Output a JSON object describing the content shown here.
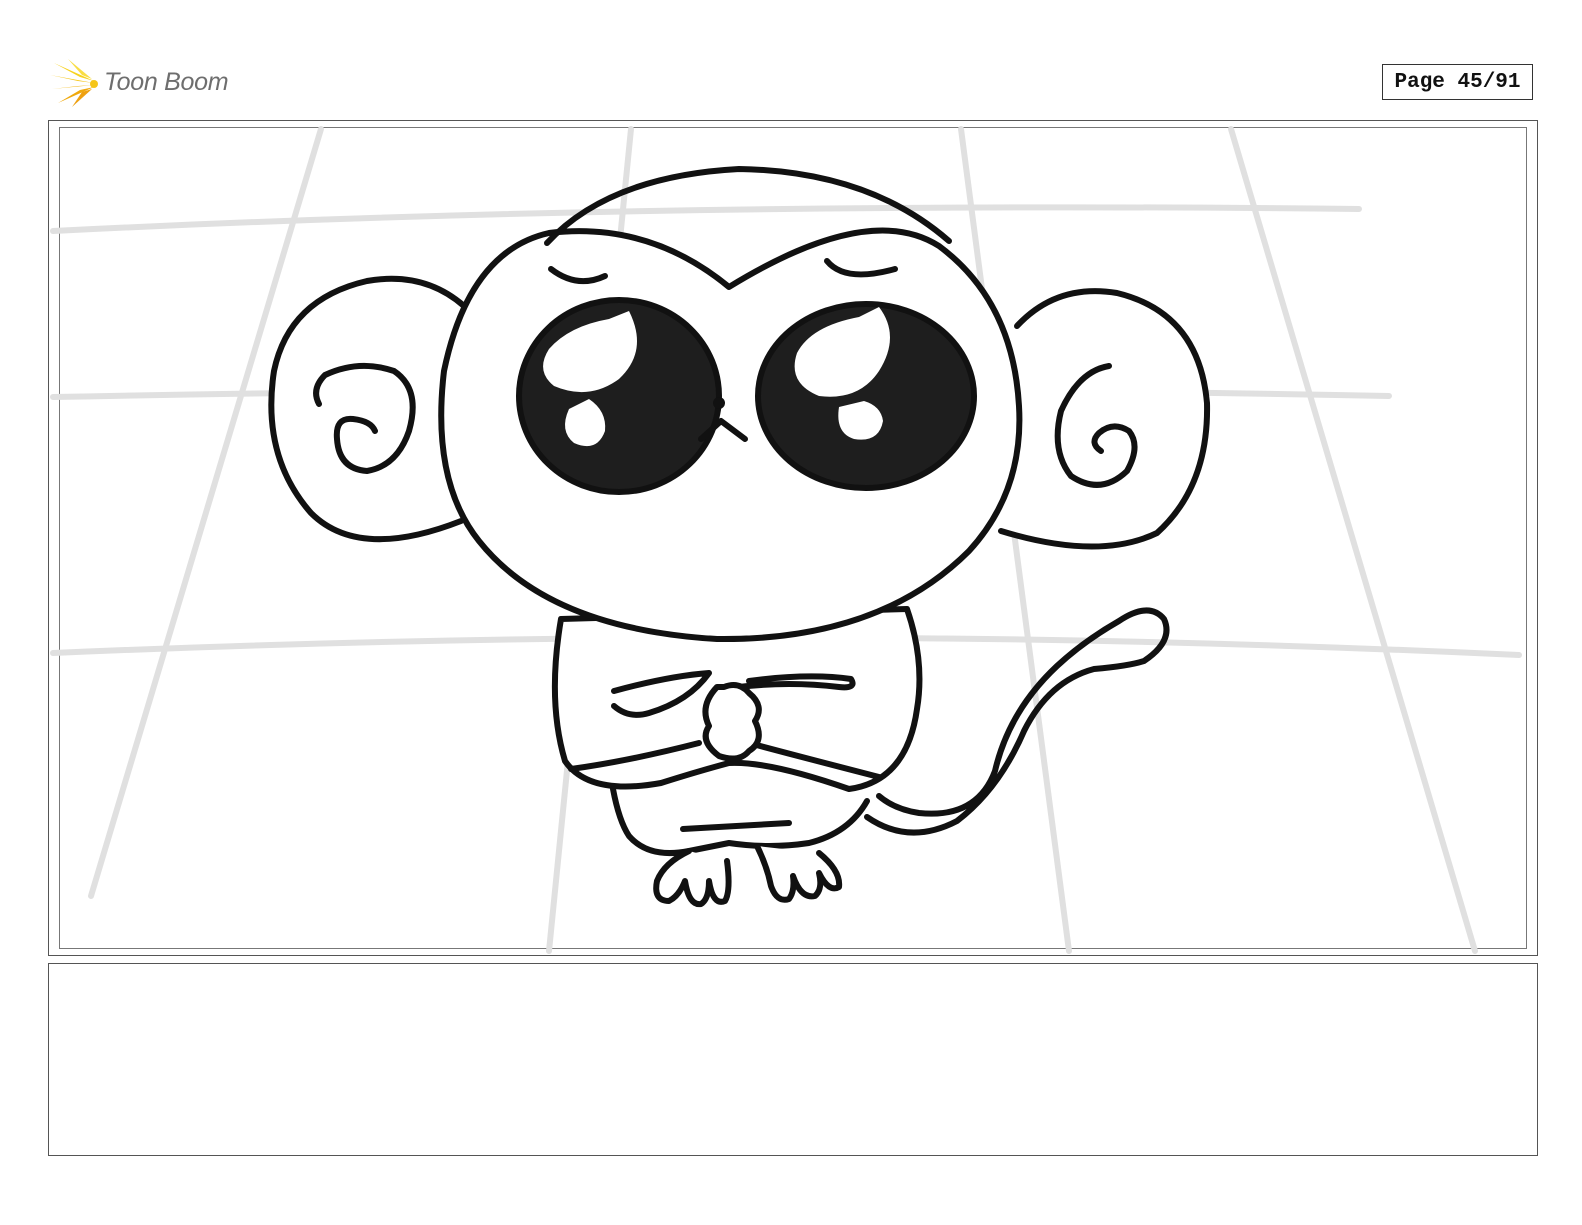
{
  "header": {
    "logo_text": "Toon Boom",
    "logo_icon": "starburst-icon",
    "page_label": "Page 45/91"
  },
  "panel": {
    "drawing": "monkey-character-sketch"
  },
  "caption": {
    "text": ""
  },
  "colors": {
    "ink": "#111111",
    "grid": "#e0e0e0",
    "logo_accent": "#f2c21b",
    "logo_text": "#6e6e6e"
  }
}
